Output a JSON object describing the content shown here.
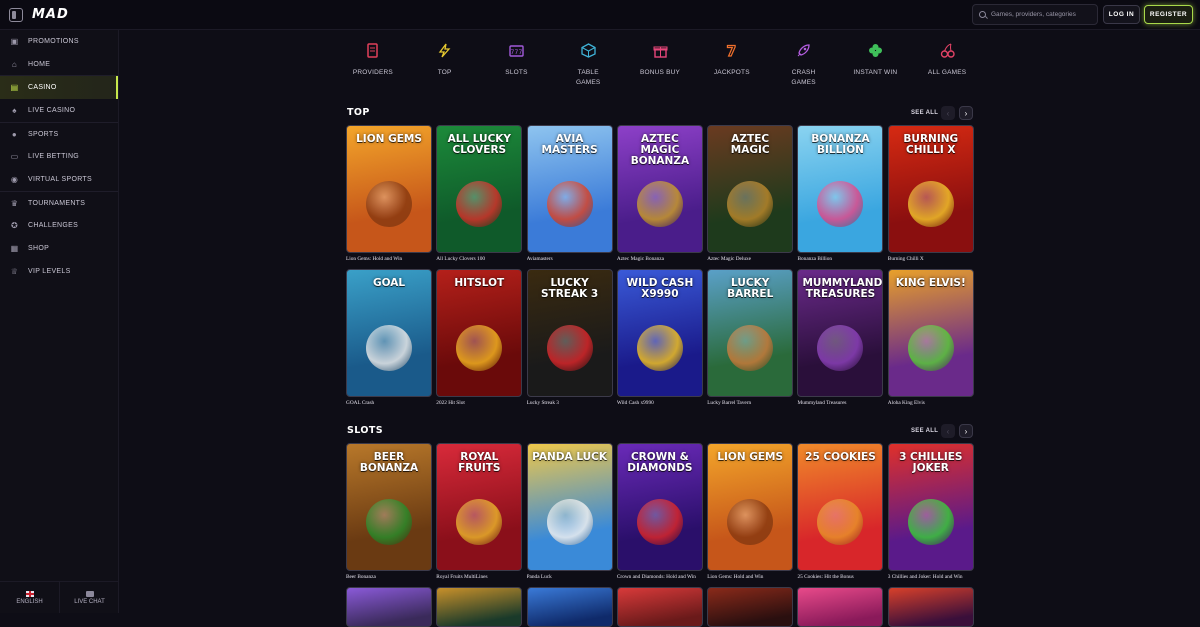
{
  "header": {
    "logo": "MAD",
    "search_placeholder": "Games, providers, categories",
    "login_label": "LOG IN",
    "register_label": "REGISTER"
  },
  "sidebar": {
    "items": [
      {
        "label": "PROMOTIONS",
        "icon": "gift-icon"
      },
      {
        "label": "HOME",
        "icon": "home-icon"
      },
      {
        "label": "CASINO",
        "icon": "casino-icon",
        "active": true
      },
      {
        "label": "LIVE CASINO",
        "icon": "live-casino-icon"
      },
      {
        "label": "SPORTS",
        "icon": "soccer-ball-icon"
      },
      {
        "label": "LIVE BETTING",
        "icon": "tv-icon"
      },
      {
        "label": "VIRTUAL SPORTS",
        "icon": "gamepad-icon"
      },
      {
        "label": "TOURNAMENTS",
        "icon": "trophy-icon"
      },
      {
        "label": "CHALLENGES",
        "icon": "medal-icon"
      },
      {
        "label": "SHOP",
        "icon": "shop-icon"
      },
      {
        "label": "VIP LEVELS",
        "icon": "crown-icon"
      }
    ],
    "language_label": "ENGLISH",
    "live_chat_label": "LIVE CHAT"
  },
  "categories": [
    {
      "label": "PROVIDERS",
      "icon": "book-icon",
      "color": "#e2405a"
    },
    {
      "label": "TOP",
      "icon": "lightning-icon",
      "color": "#e6c930"
    },
    {
      "label": "SLOTS",
      "icon": "slot-machine-icon",
      "color": "#a15ad9"
    },
    {
      "label": "TABLE GAMES",
      "icon": "cube-icon",
      "color": "#3fb3d8"
    },
    {
      "label": "BONUS BUY",
      "icon": "gift-box-icon",
      "color": "#e8467a"
    },
    {
      "label": "JACKPOTS",
      "icon": "seven-icon",
      "color": "#f0702c"
    },
    {
      "label": "CRASH GAMES",
      "icon": "rocket-icon",
      "color": "#b45de0"
    },
    {
      "label": "INSTANT WIN",
      "icon": "clover-icon",
      "color": "#3fbf5a"
    },
    {
      "label": "ALL GAMES",
      "icon": "cherries-icon",
      "color": "#e24366"
    }
  ],
  "sections": {
    "top": {
      "title": "TOP",
      "see_all": "SEE ALL",
      "rows": [
        [
          {
            "caption": "Lion Gems: Hold and Win",
            "logo": "LION GEMS",
            "bg": "#c6561a",
            "bg2": "#f3a52a",
            "art": "#8a3a10"
          },
          {
            "caption": "All Lucky Clovers 100",
            "logo": "ALL LUCKY CLOVERS",
            "bg": "#0f5a2a",
            "bg2": "#1c8a3a",
            "art": "#d2312a"
          },
          {
            "caption": "Aviamasters",
            "logo": "AVIA MASTERS",
            "bg": "#3b7bd8",
            "bg2": "#8ec4ef",
            "art": "#d8442a"
          },
          {
            "caption": "Aztec Magic Bonanza",
            "logo": "AZTEC MAGIC BONANZA",
            "bg": "#4a1d8a",
            "bg2": "#8d40c8",
            "art": "#c89a2a"
          },
          {
            "caption": "Aztec Magic Deluxe",
            "logo": "AZTEC MAGIC",
            "bg": "#1e3a1c",
            "bg2": "#6a3a20",
            "art": "#b8862a"
          },
          {
            "caption": "Bonanza Billion",
            "logo": "BONANZA BILLION",
            "bg": "#3aa6e0",
            "bg2": "#8ad3f0",
            "art": "#e04a8a"
          },
          {
            "caption": "Burning Chilli X",
            "logo": "BURNING CHILLI X",
            "bg": "#8a0f0f",
            "bg2": "#d62a12",
            "art": "#f0c02a"
          }
        ],
        [
          {
            "caption": "GOAL Crash",
            "logo": "GOAL",
            "bg": "#1a5a8a",
            "bg2": "#3aa0c8",
            "art": "#e8e8e8"
          },
          {
            "caption": "2022 Hit Slot",
            "logo": "HITSLOT",
            "bg": "#6a0a0a",
            "bg2": "#b4201a",
            "art": "#f0b020"
          },
          {
            "caption": "Lucky Streak 3",
            "logo": "LUCKY STREAK 3",
            "bg": "#1a1a1a",
            "bg2": "#3a2a10",
            "art": "#d8262a"
          },
          {
            "caption": "Wild Cash x9990",
            "logo": "WILD CASH X9990",
            "bg": "#1a1a8a",
            "bg2": "#3a5ad8",
            "art": "#f0c020"
          },
          {
            "caption": "Lucky Barrel Tavern",
            "logo": "LUCKY BARREL",
            "bg": "#2a6a3a",
            "bg2": "#5aa0c8",
            "art": "#c87a3a"
          },
          {
            "caption": "Mummyland Treasures",
            "logo": "MUMMYLAND TREASURES",
            "bg": "#2a0f3a",
            "bg2": "#6a2a8a",
            "art": "#8a40b8"
          },
          {
            "caption": "Aloha King Elvis",
            "logo": "KING ELVIS!",
            "bg": "#6a2a8a",
            "bg2": "#e8a02a",
            "art": "#5ac83a"
          }
        ]
      ]
    },
    "slots": {
      "title": "SLOTS",
      "see_all": "SEE ALL",
      "row": [
        {
          "caption": "Beer Bonanza",
          "logo": "BEER BONANZA",
          "bg": "#6a3a12",
          "bg2": "#b8782a",
          "art": "#2a8a2a"
        },
        {
          "caption": "Royal Fruits MultiLines",
          "logo": "ROYAL FRUITS",
          "bg": "#8a0f1a",
          "bg2": "#d82a3a",
          "art": "#e8b02a"
        },
        {
          "caption": "Panda Luck",
          "logo": "PANDA LUCK",
          "bg": "#3a8ad8",
          "bg2": "#f0c84a",
          "art": "#f0f0f0"
        },
        {
          "caption": "Crown and Diamonds: Hold and Win",
          "logo": "CROWN & DIAMONDS",
          "bg": "#2a0f6a",
          "bg2": "#6a2ab8",
          "art": "#d8262a"
        },
        {
          "caption": "Lion Gems: Hold and Win",
          "logo": "LION GEMS",
          "bg": "#c6561a",
          "bg2": "#f3a52a",
          "art": "#8a3a10"
        },
        {
          "caption": "25 Cookies: Hit the Bonus",
          "logo": "25 COOKIES",
          "bg": "#d8262a",
          "bg2": "#f08a2a",
          "art": "#e8902a"
        },
        {
          "caption": "3 Chillies and Joker: Hold and Win",
          "logo": "3 CHILLIES JOKER",
          "bg": "#5a1a8a",
          "bg2": "#e0302a",
          "art": "#3ac83a"
        }
      ]
    },
    "peek_row": [
      {
        "bg": "#3a2a5a",
        "bg2": "#8a5ad8"
      },
      {
        "bg": "#1a3a2a",
        "bg2": "#c8902a"
      },
      {
        "bg": "#0f2a6a",
        "bg2": "#3a7ad8"
      },
      {
        "bg": "#6a1a1a",
        "bg2": "#d83a3a"
      },
      {
        "bg": "#2a0f0f",
        "bg2": "#8a2a1a"
      },
      {
        "bg": "#8a1a5a",
        "bg2": "#e84a8a"
      },
      {
        "bg": "#3a0f3a",
        "bg2": "#d8402a"
      }
    ]
  }
}
